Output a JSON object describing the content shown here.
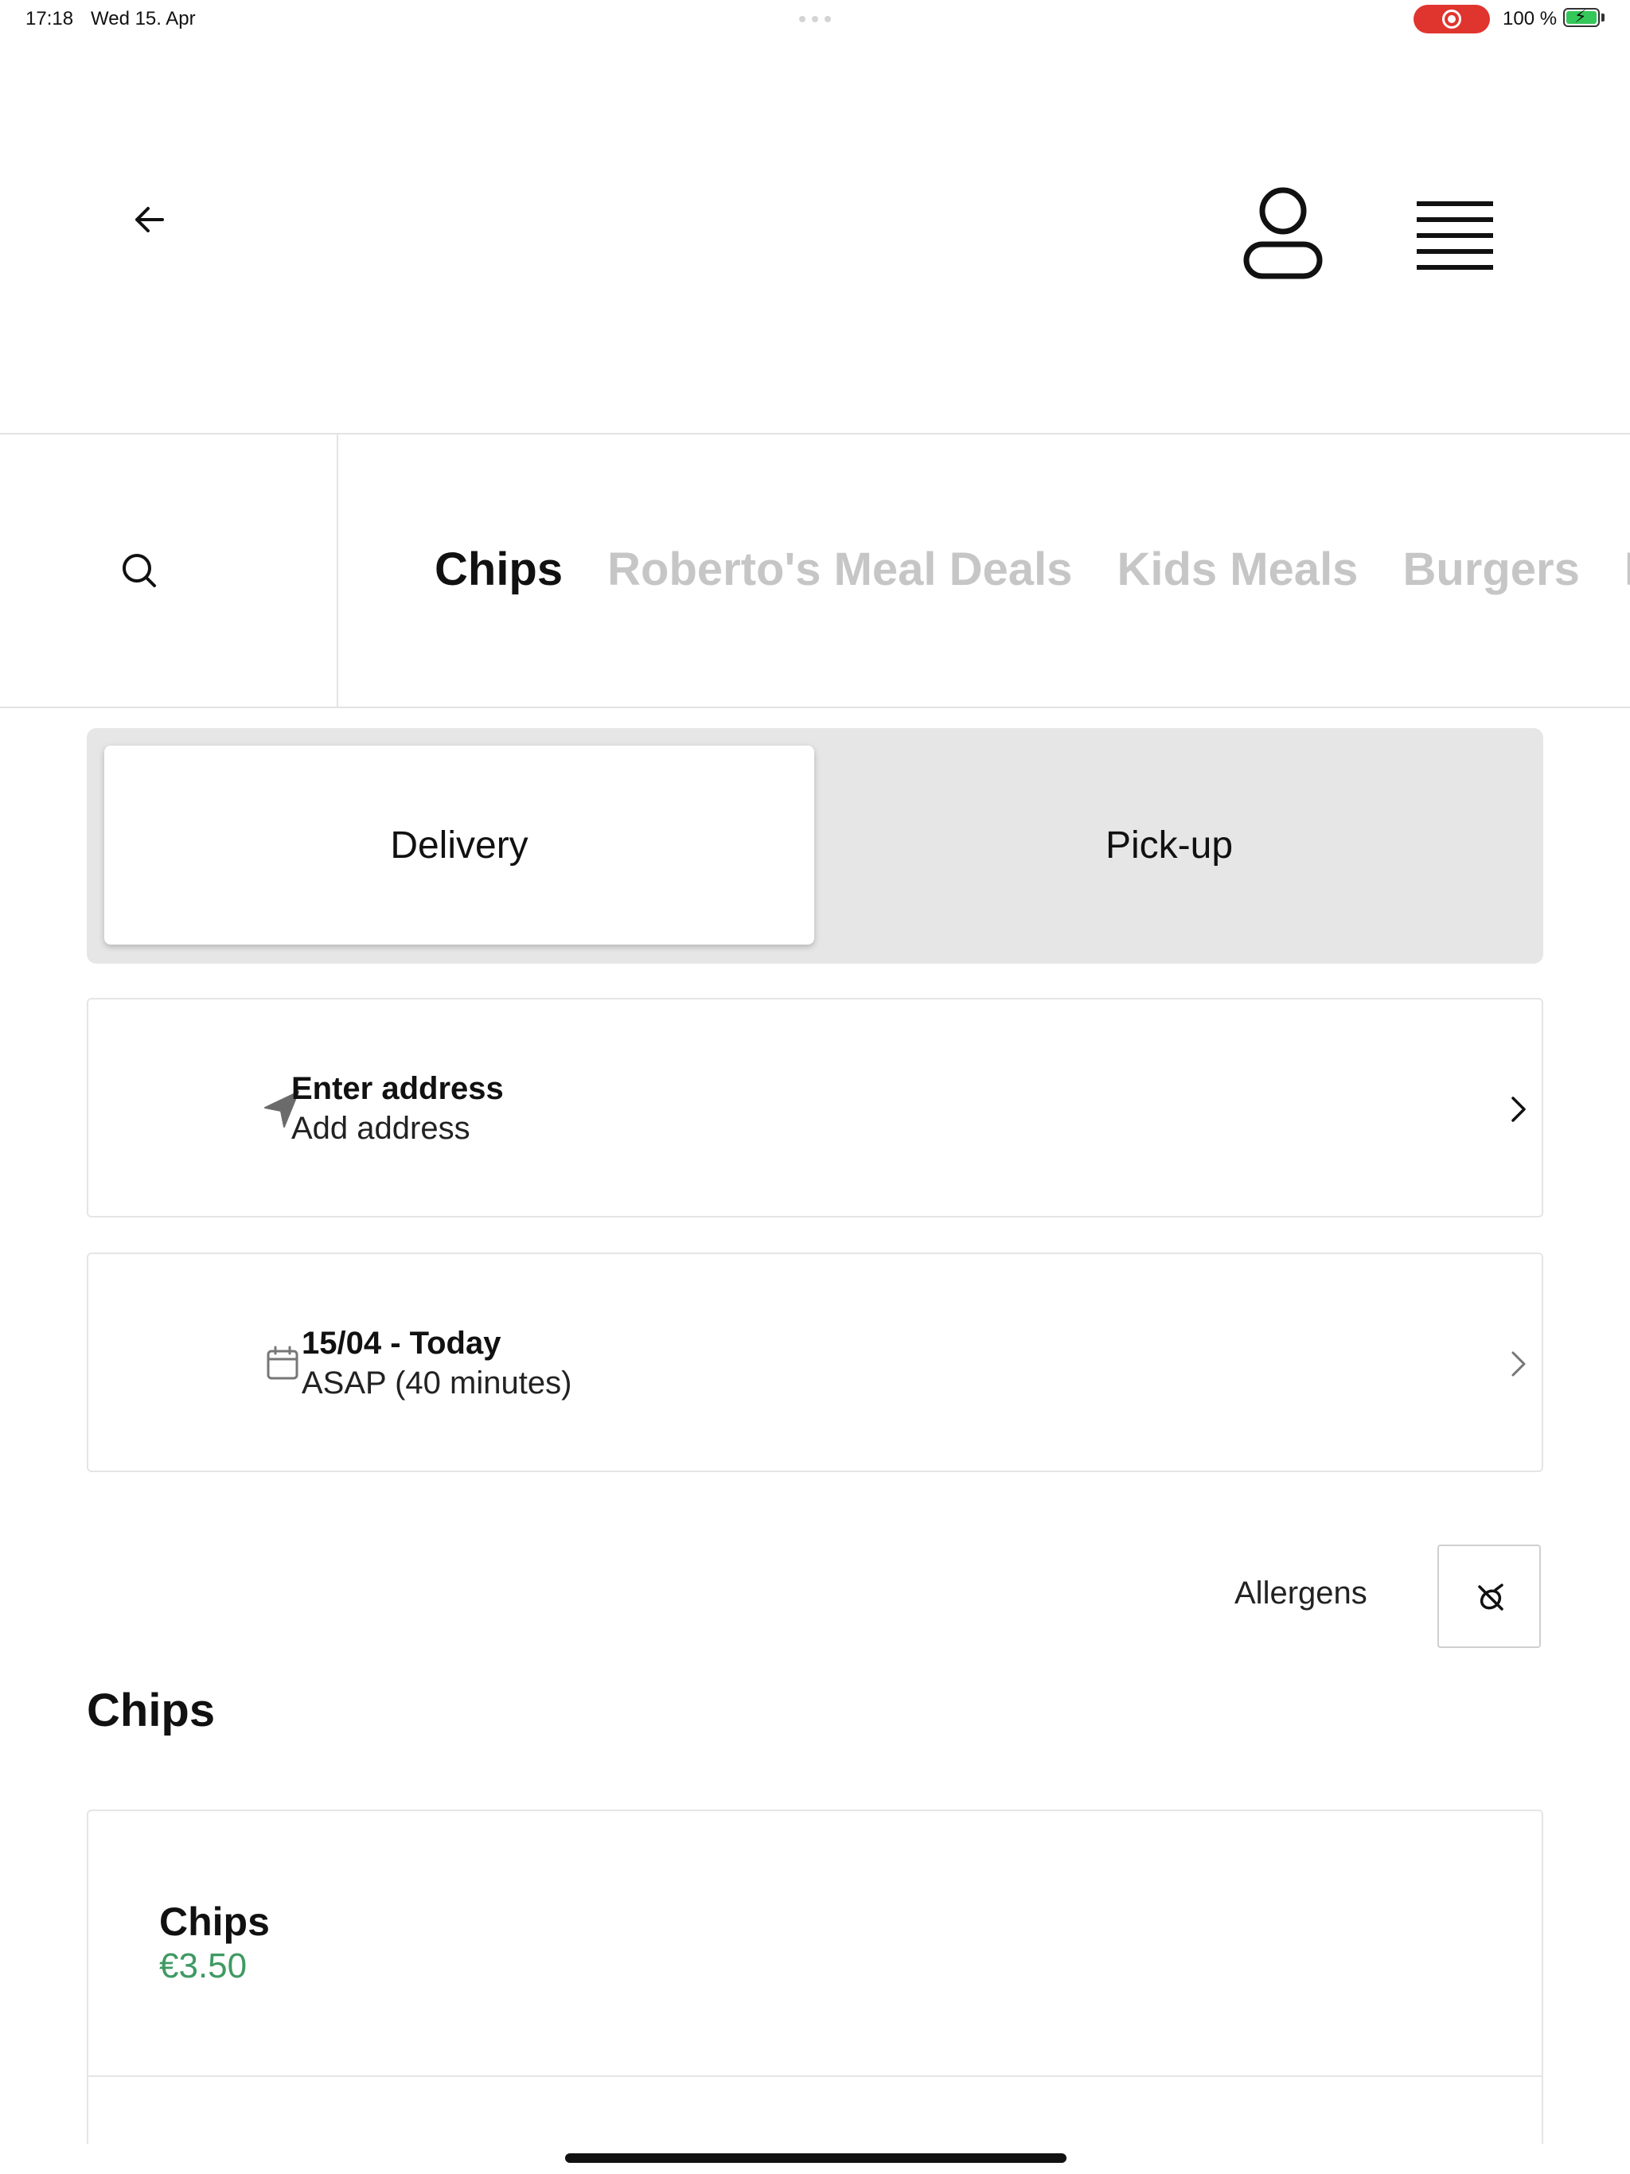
{
  "status_bar": {
    "time": "17:18",
    "date": "Wed 15. Apr",
    "battery": "100 %",
    "recording_color": "#e0342e",
    "battery_color": "#34c759"
  },
  "header": {
    "back_icon": "arrow-left-icon",
    "account_icon": "user-icon",
    "menu_icon": "hamburger-menu-icon"
  },
  "categories": {
    "search_icon": "search-icon",
    "tabs": [
      {
        "label": "Chips",
        "active": true
      },
      {
        "label": "Roberto's Meal Deals",
        "active": false
      },
      {
        "label": "Kids Meals",
        "active": false
      },
      {
        "label": "Burgers",
        "active": false
      },
      {
        "label": "F",
        "active": false
      }
    ]
  },
  "order_mode": {
    "delivery_label": "Delivery",
    "pickup_label": "Pick-up",
    "selected": "Delivery"
  },
  "address": {
    "title": "Enter address",
    "subtitle": "Add address",
    "icon": "location-arrow-icon"
  },
  "schedule": {
    "title": "15/04 - Today",
    "subtitle": "ASAP (40 minutes)",
    "icon": "calendar-icon"
  },
  "allergens": {
    "label": "Allergens",
    "icon": "allergen-filter-icon"
  },
  "section": {
    "title": "Chips",
    "products": [
      {
        "name": "Chips",
        "price": "€3.50"
      }
    ],
    "price_color": "#3f9a62"
  }
}
